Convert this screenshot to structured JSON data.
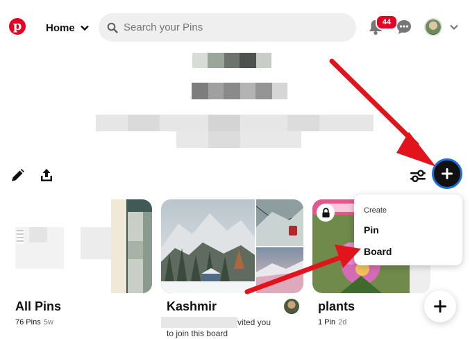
{
  "header": {
    "home_label": "Home",
    "search_placeholder": "Search your Pins",
    "notification_count": "44"
  },
  "menu": {
    "caption": "Create",
    "items": [
      "Pin",
      "Board"
    ]
  },
  "boards": [
    {
      "title": "All Pins",
      "count": "76 Pins",
      "age": "5w"
    },
    {
      "title": "Kashmir",
      "invite_line1": "vited you",
      "invite_line2": "to join this board"
    },
    {
      "title": "plants",
      "count": "1 Pin",
      "age": "2d"
    }
  ],
  "colors": {
    "brand": "#e60023",
    "accent_ring": "#1b6fd8",
    "annotation_arrow": "#e0141a"
  }
}
